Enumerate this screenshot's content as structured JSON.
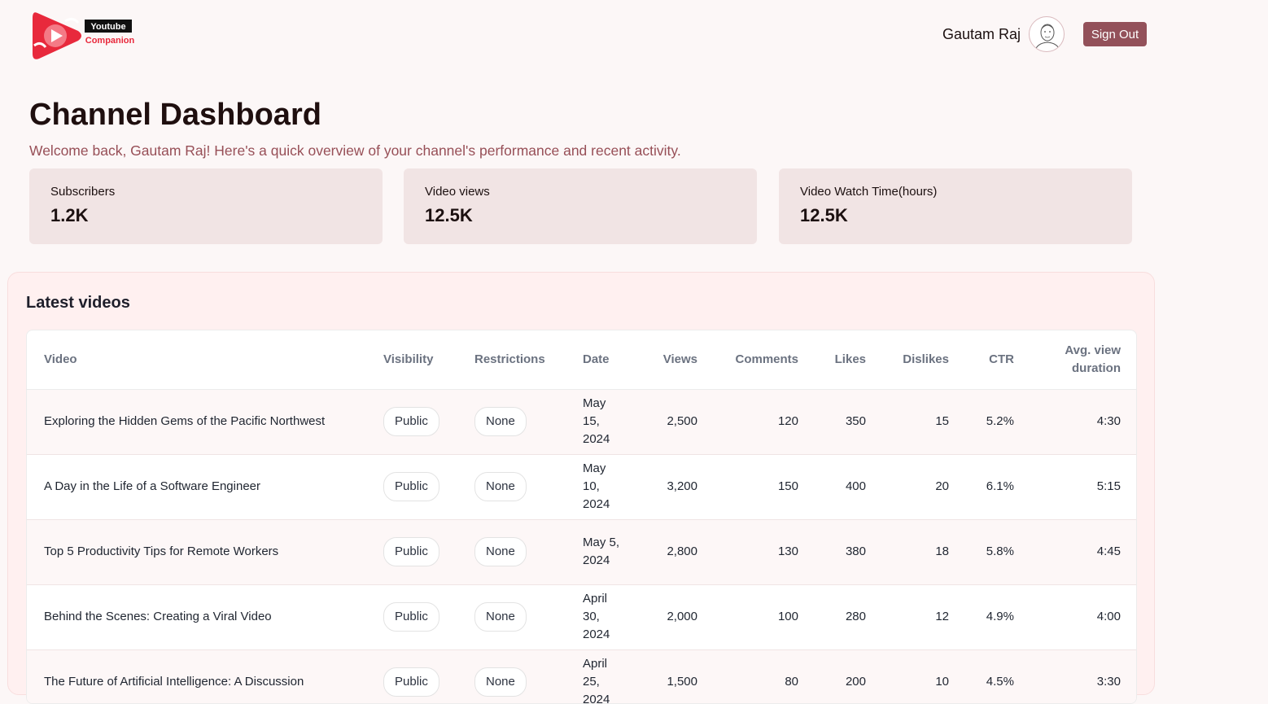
{
  "brand": {
    "logo_line1": "Youtube",
    "logo_line2": "Companion",
    "accent": "#e8293c"
  },
  "user": {
    "name": "Gautam Raj",
    "sign_out_label": "Sign Out"
  },
  "page": {
    "title": "Channel Dashboard",
    "welcome": "Welcome back, Gautam Raj! Here's a quick overview of your channel's performance and recent activity."
  },
  "stats": [
    {
      "label": "Subscribers",
      "value": "1.2K"
    },
    {
      "label": "Video views",
      "value": "12.5K"
    },
    {
      "label": "Video Watch Time(hours)",
      "value": "12.5K"
    }
  ],
  "latest": {
    "title": "Latest videos",
    "headers": [
      "Video",
      "Visibility",
      "Restrictions",
      "Date",
      "Views",
      "Comments",
      "Likes",
      "Dislikes",
      "CTR",
      "Avg. view duration"
    ],
    "rows": [
      {
        "video": "Exploring the Hidden Gems of the Pacific Northwest",
        "visibility": "Public",
        "restrictions": "None",
        "date": "May 15, 2024",
        "views": "2,500",
        "comments": "120",
        "likes": "350",
        "dislikes": "15",
        "ctr": "5.2%",
        "avg": "4:30"
      },
      {
        "video": "A Day in the Life of a Software Engineer",
        "visibility": "Public",
        "restrictions": "None",
        "date": "May 10, 2024",
        "views": "3,200",
        "comments": "150",
        "likes": "400",
        "dislikes": "20",
        "ctr": "6.1%",
        "avg": "5:15"
      },
      {
        "video": "Top 5 Productivity Tips for Remote Workers",
        "visibility": "Public",
        "restrictions": "None",
        "date": "May 5, 2024",
        "views": "2,800",
        "comments": "130",
        "likes": "380",
        "dislikes": "18",
        "ctr": "5.8%",
        "avg": "4:45"
      },
      {
        "video": "Behind the Scenes: Creating a Viral Video",
        "visibility": "Public",
        "restrictions": "None",
        "date": "April 30, 2024",
        "views": "2,000",
        "comments": "100",
        "likes": "280",
        "dislikes": "12",
        "ctr": "4.9%",
        "avg": "4:00"
      },
      {
        "video": "The Future of Artificial Intelligence: A Discussion",
        "visibility": "Public",
        "restrictions": "None",
        "date": "April 25, 2024",
        "views": "1,500",
        "comments": "80",
        "likes": "200",
        "dislikes": "10",
        "ctr": "4.5%",
        "avg": "3:30"
      }
    ]
  }
}
